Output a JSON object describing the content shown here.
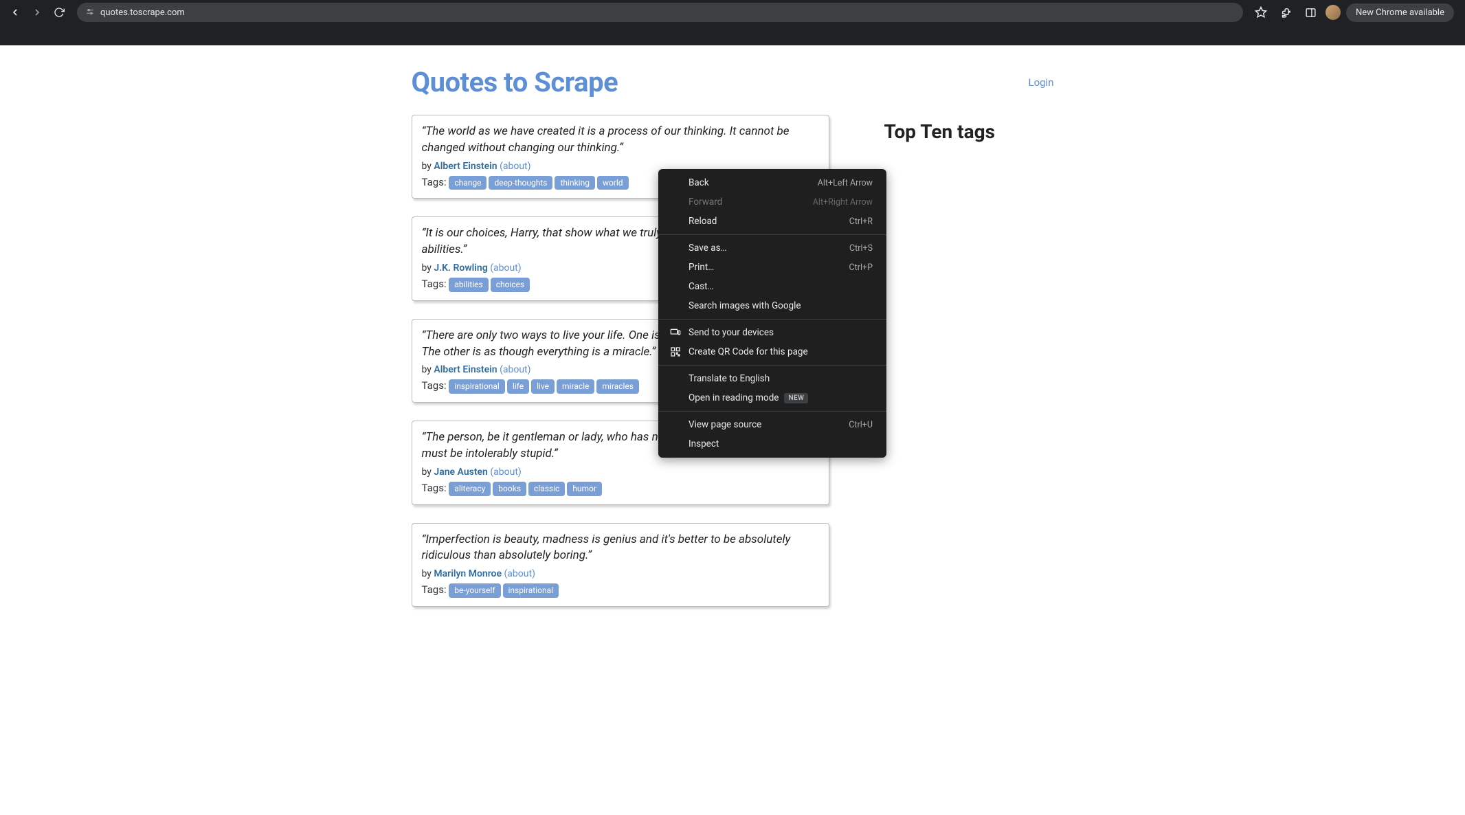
{
  "browser": {
    "url": "quotes.toscrape.com",
    "notice": "New Chrome available"
  },
  "header": {
    "title": "Quotes to Scrape",
    "login": "Login"
  },
  "quotes": [
    {
      "text": "“The world as we have created it is a process of our thinking. It cannot be changed without changing our thinking.”",
      "by": "by ",
      "author": "Albert Einstein",
      "about": "(about)",
      "tags_label": "Tags:",
      "tags": [
        "change",
        "deep-thoughts",
        "thinking",
        "world"
      ]
    },
    {
      "text": "“It is our choices, Harry, that show what we truly are, far more than our abilities.”",
      "by": "by ",
      "author": "J.K. Rowling",
      "about": "(about)",
      "tags_label": "Tags:",
      "tags": [
        "abilities",
        "choices"
      ]
    },
    {
      "text": "“There are only two ways to live your life. One is as though nothing is a miracle. The other is as though everything is a miracle.”",
      "by": "by ",
      "author": "Albert Einstein",
      "about": "(about)",
      "tags_label": "Tags:",
      "tags": [
        "inspirational",
        "life",
        "live",
        "miracle",
        "miracles"
      ]
    },
    {
      "text": "“The person, be it gentleman or lady, who has not pleasure in a good novel, must be intolerably stupid.”",
      "by": "by ",
      "author": "Jane Austen",
      "about": "(about)",
      "tags_label": "Tags:",
      "tags": [
        "aliteracy",
        "books",
        "classic",
        "humor"
      ]
    },
    {
      "text": "“Imperfection is beauty, madness is genius and it's better to be absolutely ridiculous than absolutely boring.”",
      "by": "by ",
      "author": "Marilyn Monroe",
      "about": "(about)",
      "tags_label": "Tags:",
      "tags": [
        "be-yourself",
        "inspirational"
      ]
    }
  ],
  "sidebar": {
    "title": "Top Ten tags"
  },
  "context_menu": {
    "groups": [
      [
        {
          "label": "Back",
          "shortcut": "Alt+Left Arrow",
          "enabled": true
        },
        {
          "label": "Forward",
          "shortcut": "Alt+Right Arrow",
          "enabled": false
        },
        {
          "label": "Reload",
          "shortcut": "Ctrl+R",
          "enabled": true
        }
      ],
      [
        {
          "label": "Save as…",
          "shortcut": "Ctrl+S",
          "enabled": true
        },
        {
          "label": "Print…",
          "shortcut": "Ctrl+P",
          "enabled": true
        },
        {
          "label": "Cast…",
          "shortcut": "",
          "enabled": true
        },
        {
          "label": "Search images with Google",
          "shortcut": "",
          "enabled": true
        }
      ],
      [
        {
          "label": "Send to your devices",
          "shortcut": "",
          "enabled": true,
          "icon": "devices"
        },
        {
          "label": "Create QR Code for this page",
          "shortcut": "",
          "enabled": true,
          "icon": "qr"
        }
      ],
      [
        {
          "label": "Translate to English",
          "shortcut": "",
          "enabled": true
        },
        {
          "label": "Open in reading mode",
          "shortcut": "",
          "enabled": true,
          "badge": "NEW"
        }
      ],
      [
        {
          "label": "View page source",
          "shortcut": "Ctrl+U",
          "enabled": true
        },
        {
          "label": "Inspect",
          "shortcut": "",
          "enabled": true
        }
      ]
    ]
  }
}
